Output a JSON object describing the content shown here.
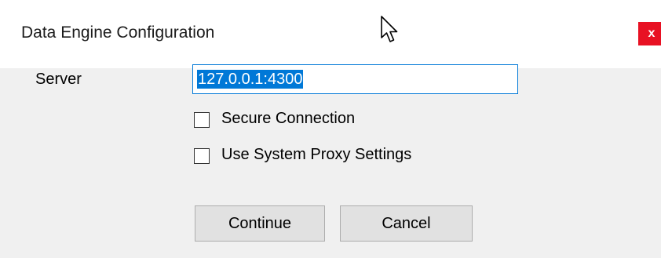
{
  "window": {
    "title": "Data Engine Configuration",
    "close_glyph": "x",
    "close_color": "#e81123"
  },
  "form": {
    "server_label": "Server",
    "server_value": "127.0.0.1:4300",
    "server_value_selected": true,
    "secure_label": "Secure Connection",
    "secure_checked": false,
    "proxy_label": "Use System Proxy Settings",
    "proxy_checked": false
  },
  "buttons": {
    "continue_label": "Continue",
    "cancel_label": "Cancel"
  },
  "colors": {
    "selection": "#0078d7",
    "dialog_bg": "#f0f0f0",
    "button_bg": "#e1e1e1"
  },
  "icons": {
    "cursor": "mouse-pointer-icon",
    "close": "close-icon"
  }
}
